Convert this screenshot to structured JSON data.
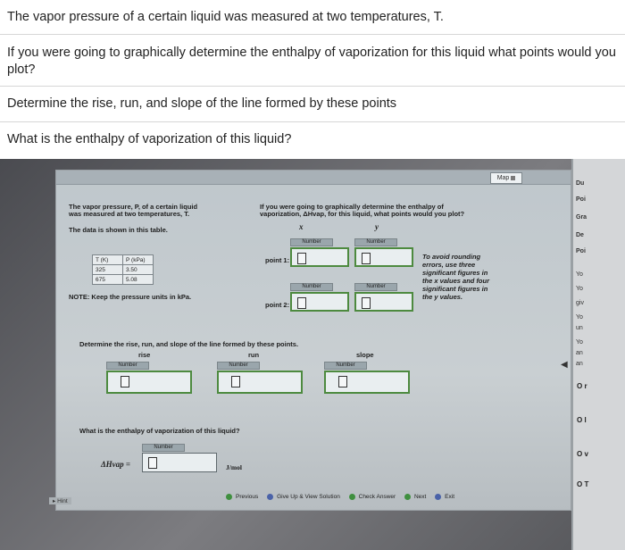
{
  "questions": {
    "q1": "The vapor pressure of a certain liquid was measured at two temperatures, T.",
    "q2": "If you were going to graphically determine the enthalpy of vaporization for this liquid what points would you plot?",
    "q3": "Determine the rise, run, and slope of the line formed by these points",
    "q4": "What is the enthalpy of vaporization of this liquid?"
  },
  "screen": {
    "map_label": "Map",
    "intro_line1": "The vapor pressure, P, of a certain liquid",
    "intro_line2": "was measured at two temperatures, T.",
    "data_note": "The data is shown in this table.",
    "table": {
      "headers": [
        "T (K)",
        "P (kPa)"
      ],
      "rows": [
        [
          "325",
          "3.50"
        ],
        [
          "675",
          "5.08"
        ]
      ]
    },
    "pressure_note": "NOTE: Keep the pressure units in kPa.",
    "plot_q_line1": "If you were going to graphically determine the enthalpy of",
    "plot_q_line2": "vaporization, ΔHvap, for this liquid, what points would you plot?",
    "x_label": "x",
    "y_label": "y",
    "number_tag": "Number",
    "point1_label": "point 1:",
    "point2_label": "point 2:",
    "rounding_note": [
      "To avoid rounding",
      "errors, use three",
      "significant figures in",
      "the x values and four",
      "significant figures in",
      "the y values."
    ],
    "rise_run_q": "Determine the rise, run, and slope of the line formed by these points.",
    "rise_label": "rise",
    "run_label": "run",
    "slope_label": "slope",
    "enthalpy_q": "What is the enthalpy of vaporization of this liquid?",
    "enthalpy_symbol": "ΔHvap =",
    "enthalpy_unit": "J/mol",
    "nav": {
      "previous": "Previous",
      "give_up": "Give Up & View Solution",
      "check": "Check Answer",
      "next": "Next",
      "exit": "Exit"
    },
    "hint": "Hint"
  },
  "side_panel": {
    "items": [
      "Du",
      "Poi",
      "Gra",
      "De",
      "Poi",
      "Yo",
      "Yo",
      "giv",
      "Yo",
      "un",
      "Yo",
      "an",
      "an"
    ],
    "options": [
      "O r",
      "O l",
      "O v",
      "O T"
    ]
  }
}
